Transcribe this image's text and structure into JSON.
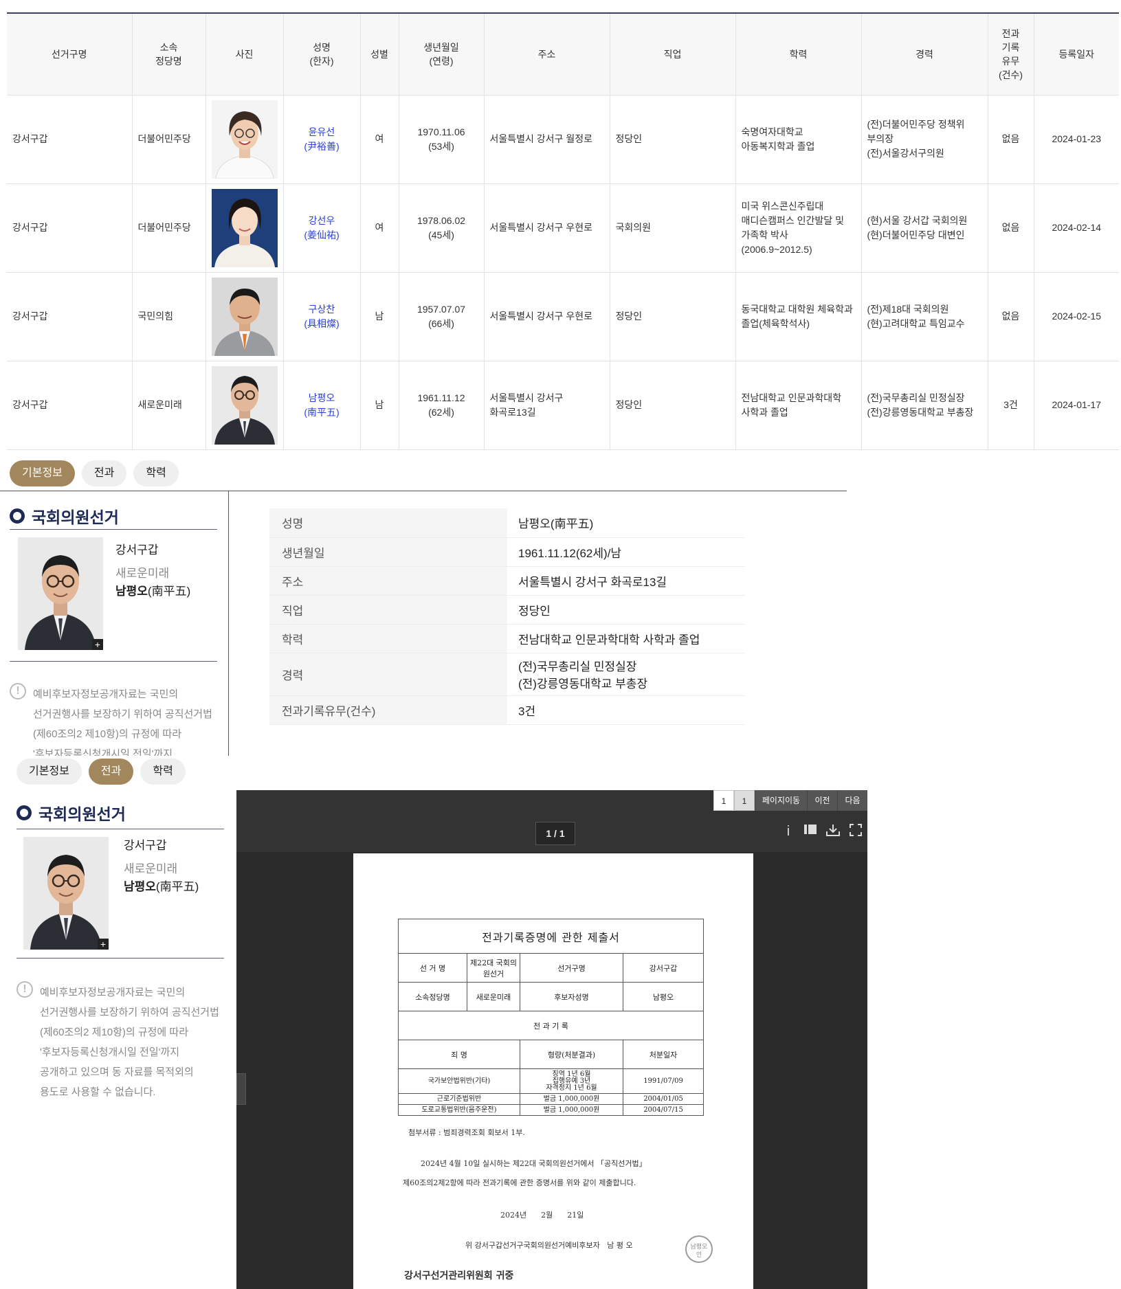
{
  "table": {
    "headers": [
      "선거구명",
      "소속\n정당명",
      "사진",
      "성명\n(한자)",
      "성별",
      "생년월일\n(연령)",
      "주소",
      "직업",
      "학력",
      "경력",
      "전과\n기록\n유무\n(건수)",
      "등록일자"
    ],
    "rows": [
      {
        "district": "강서구갑",
        "party": "더불어민주당",
        "name": "윤유선",
        "hanja": "(尹裕善)",
        "gender": "여",
        "birth": "1970.11.06",
        "age": "(53세)",
        "address": "서울특별시 강서구 월정로",
        "job": "정당인",
        "edu": "숙명여자대학교\n아동복지학과 졸업",
        "career": "(전)더불어민주당 정책위\n부의장\n(전)서울강서구의원",
        "record": "없음",
        "date": "2024-01-23",
        "photo": "female-smiling-portrait"
      },
      {
        "district": "강서구갑",
        "party": "더불어민주당",
        "name": "강선우",
        "hanja": "(姜仙祐)",
        "gender": "여",
        "birth": "1978.06.02",
        "age": "(45세)",
        "address": "서울특별시 강서구 우현로",
        "job": "국회의원",
        "edu": "미국 위스콘신주립대\n매디슨캠퍼스 인간발달 및\n가족학 박사\n(2006.9~2012.5)",
        "career": "(현)서울 강서갑 국회의원\n(현)더불어민주당 대변인",
        "record": "없음",
        "date": "2024-02-14",
        "photo": "female-portrait"
      },
      {
        "district": "강서구갑",
        "party": "국민의힘",
        "name": "구상찬",
        "hanja": "(具相燦)",
        "gender": "남",
        "birth": "1957.07.07",
        "age": "(66세)",
        "address": "서울특별시 강서구 우현로",
        "job": "정당인",
        "edu": "동국대학교 대학원 체육학과\n졸업(체육학석사)",
        "career": "(전)제18대 국회의원\n(현)고려대학교 특임교수",
        "record": "없음",
        "date": "2024-02-15",
        "photo": "male-portrait-orange-tie"
      },
      {
        "district": "강서구갑",
        "party": "새로운미래",
        "name": "남평오",
        "hanja": "(南平五)",
        "gender": "남",
        "birth": "1961.11.12",
        "age": "(62세)",
        "address": "서울특별시 강서구\n화곡로13길",
        "job": "정당인",
        "edu": "전남대학교 인문과학대학\n사학과 졸업",
        "career": "(전)국무총리실 민정실장\n(전)강릉영동대학교 부총장",
        "record": "3건",
        "date": "2024-01-17",
        "photo": "male-portrait-glasses"
      }
    ]
  },
  "tabs": [
    "기본정보",
    "전과",
    "학력"
  ],
  "side": {
    "title": "국회의원선거",
    "district": "강서구갑",
    "party": "새로운미래",
    "name": "남평오",
    "hanja": "(南平五)",
    "plus": "+",
    "notice": [
      "예비후보자정보공개자료는 국민의",
      "선거권행사를 보장하기 위하여 공직선거법",
      "(제60조의2 제10항)의 규정에 따라",
      "'후보자등록신청개시일 전일'까지",
      "공개하고 있으며 동 자료를 목적외의",
      "용도로 사용할 수 없습니다."
    ]
  },
  "detail": {
    "rows": [
      {
        "k": "성명",
        "v": "남평오(南平五)"
      },
      {
        "k": "생년월일",
        "v": "1961.11.12(62세)/남"
      },
      {
        "k": "주소",
        "v": "서울특별시 강서구 화곡로13길"
      },
      {
        "k": "직업",
        "v": "정당인"
      },
      {
        "k": "학력",
        "v": "전남대학교 인문과학대학 사학과 졸업"
      },
      {
        "k": "경력",
        "v": "(전)국무총리실 민정실장\n(전)강릉영동대학교 부총장"
      },
      {
        "k": "전과기록유무(건수)",
        "v": "3건"
      }
    ]
  },
  "viewer": {
    "pagebar": [
      "1",
      "1",
      "페이지이동",
      "이전",
      "다음"
    ],
    "pager": "1 / 1",
    "icons": [
      "info-icon",
      "panel-icon",
      "download-icon",
      "fullscreen-icon"
    ],
    "doc": {
      "title": "전과기록증명에 관한 제출서",
      "r1": [
        "선 거 명",
        "제22대 국회의원선거",
        "선거구명",
        "강서구갑"
      ],
      "r2": [
        "소속정당명",
        "새로운미래",
        "후보자성명",
        "남평오"
      ],
      "section": "전 과 기 록",
      "cols": [
        "죄 명",
        "형량(처분결과)",
        "처분일자"
      ],
      "records": [
        {
          "crime": "국가보안법위반(기타)",
          "sentence": "징역 1년 6월\n집행유예 3년\n자격정지 1년 6월",
          "date": "1991/07/09"
        },
        {
          "crime": "근로기준법위반",
          "sentence": "벌금 1,000,000원",
          "date": "2004/01/05"
        },
        {
          "crime": "도로교통법위반(음주운전)",
          "sentence": "벌금 1,000,000원",
          "date": "2004/07/15"
        }
      ],
      "attach": "첨부서류 : 범죄경력조회 회보서 1부.",
      "body1": "2024년 4월 10일 실시하는 제22대 국회의원선거에서 「공직선거법」",
      "body2": "제60조의2제2항에 따라 전과기록에 관한 증명서를 위와 같이 제출합니다.",
      "date": "2024년      2월      21일",
      "sign": "위 강서구갑선거구국회의원선거예비후보자   남 평 오",
      "to": "강서구선거관리위원회 귀중",
      "seal": "남평오\n인"
    }
  }
}
